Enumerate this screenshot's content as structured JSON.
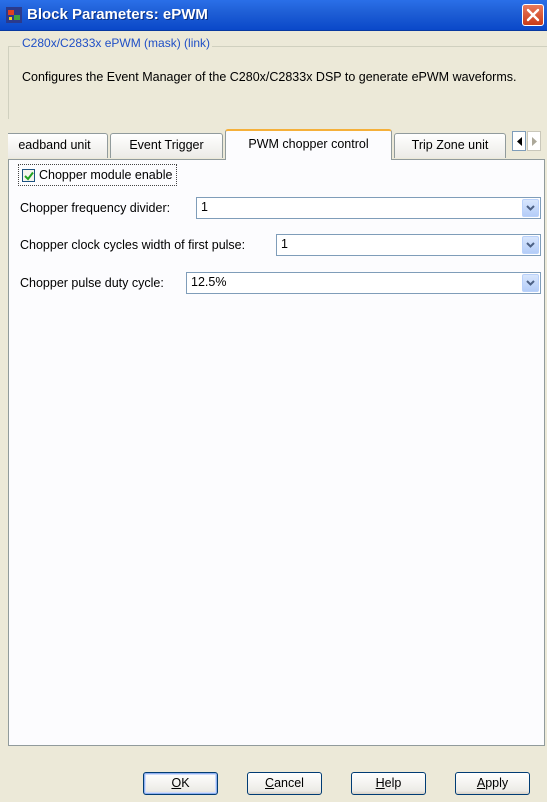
{
  "window": {
    "title": "Block Parameters: ePWM",
    "close_icon": "close-icon",
    "app_icon": "simulink-block-icon"
  },
  "group": {
    "legend": "C280x/C2833x ePWM (mask) (link)",
    "description": "Configures the Event Manager of the C280x/C2833x DSP to generate ePWM waveforms."
  },
  "tabs": [
    {
      "label": "eadband unit",
      "active": false
    },
    {
      "label": "Event Trigger",
      "active": false
    },
    {
      "label": "PWM chopper control",
      "active": true
    },
    {
      "label": "Trip Zone unit",
      "active": false
    }
  ],
  "tab_scroll": {
    "left_icon": "arrow-left-icon",
    "right_icon": "arrow-right-icon"
  },
  "params": {
    "chopper_enable": {
      "label": "Chopper module enable",
      "checked": true
    },
    "freq_divider": {
      "label": "Chopper frequency divider:",
      "value": "1"
    },
    "first_pulse": {
      "label": "Chopper clock cycles width of first pulse:",
      "value": "1"
    },
    "duty_cycle": {
      "label": "Chopper pulse duty cycle:",
      "value": "12.5%"
    }
  },
  "buttons": {
    "ok": {
      "mnemonic": "O",
      "rest": "K"
    },
    "cancel": {
      "mnemonic": "C",
      "rest": "ancel"
    },
    "help": {
      "mnemonic": "H",
      "rest": "elp"
    },
    "apply": {
      "mnemonic": "A",
      "rest": "pply"
    }
  },
  "colors": {
    "titlebar": "#0a48c9",
    "legend_text": "#1f4fc6",
    "active_tab_accent": "#f5b03a",
    "dialog_bg": "#ece9d8"
  }
}
